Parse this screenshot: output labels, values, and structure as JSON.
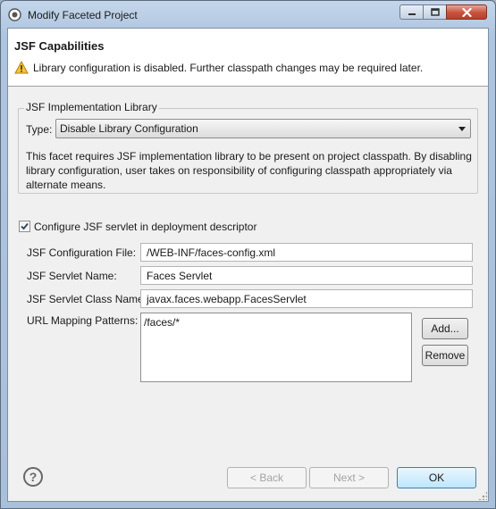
{
  "window": {
    "title": "Modify Faceted Project"
  },
  "banner": {
    "title": "JSF Capabilities",
    "message": "Library configuration is disabled. Further classpath changes may be required later.",
    "icon": "warning-icon"
  },
  "library": {
    "group_label": "JSF Implementation Library",
    "type_label": "Type:",
    "type_value": "Disable Library Configuration",
    "description": "This facet requires JSF implementation library to be present on project classpath. By disabling library configuration, user takes on responsibility of configuring classpath appropriately via alternate means."
  },
  "servlet": {
    "checkbox_label": "Configure JSF servlet in deployment descriptor",
    "checked": true,
    "config_file_label": "JSF Configuration File:",
    "config_file_value": "/WEB-INF/faces-config.xml",
    "name_label": "JSF Servlet Name:",
    "name_value": "Faces Servlet",
    "class_label": "JSF Servlet Class Name:",
    "class_value": "javax.faces.webapp.FacesServlet",
    "url_label": "URL Mapping Patterns:",
    "url_patterns": [
      "/faces/*"
    ],
    "add_label": "Add...",
    "remove_label": "Remove"
  },
  "footer": {
    "back_label": "< Back",
    "next_label": "Next >",
    "ok_label": "OK",
    "help_glyph": "?"
  }
}
